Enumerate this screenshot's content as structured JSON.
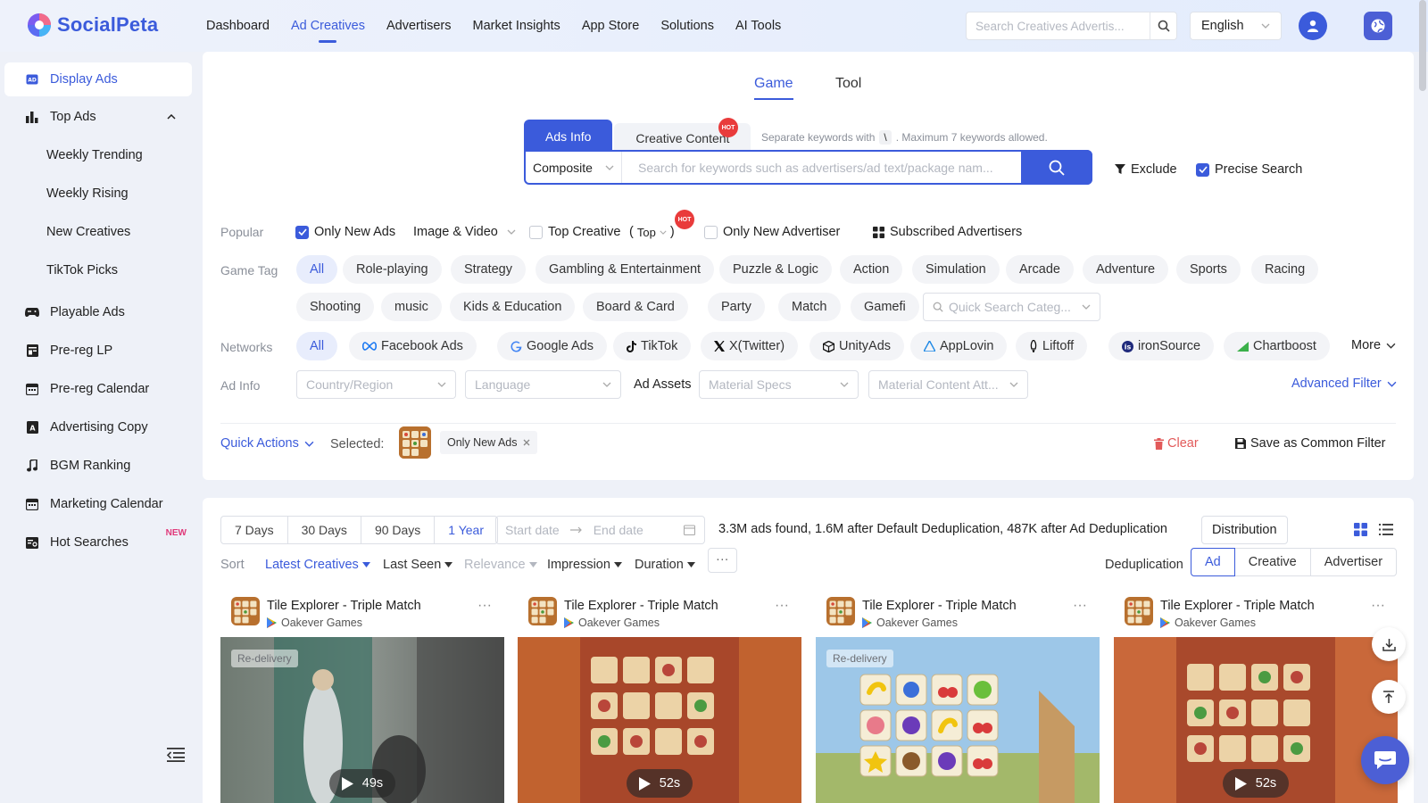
{
  "app": {
    "name": "SocialPeta",
    "brand_color": "#3b5bdb"
  },
  "nav": {
    "items": [
      {
        "label": "Dashboard"
      },
      {
        "label": "Ad Creatives",
        "active": true
      },
      {
        "label": "Advertisers"
      },
      {
        "label": "Market Insights"
      },
      {
        "label": "App Store"
      },
      {
        "label": "Solutions"
      },
      {
        "label": "AI Tools"
      }
    ],
    "search_placeholder": "Search Creatives Advertis...",
    "language": "English"
  },
  "sidebar": {
    "items": [
      {
        "label": "Display Ads",
        "icon": "ad-icon",
        "active": true
      },
      {
        "label": "Top Ads",
        "icon": "bar-chart-icon",
        "expanded": true
      },
      {
        "label": "Weekly Trending",
        "sub": true
      },
      {
        "label": "Weekly Rising",
        "sub": true
      },
      {
        "label": "New Creatives",
        "sub": true
      },
      {
        "label": "TikTok Picks",
        "sub": true
      },
      {
        "label": "Playable Ads",
        "icon": "gamepad-icon"
      },
      {
        "label": "Pre-reg LP",
        "icon": "page-icon"
      },
      {
        "label": "Pre-reg Calendar",
        "icon": "calendar-icon"
      },
      {
        "label": "Advertising Copy",
        "icon": "copy-icon"
      },
      {
        "label": "BGM Ranking",
        "icon": "music-icon"
      },
      {
        "label": "Marketing Calendar",
        "icon": "calendar-icon"
      },
      {
        "label": "Hot Searches",
        "icon": "search-list-icon",
        "badge": "NEW"
      }
    ]
  },
  "filters": {
    "category_tabs": [
      "Game",
      "Tool"
    ],
    "active_category": "Game",
    "search_tabs": [
      "Ads Info",
      "Creative Content"
    ],
    "hot_badge": "HOT",
    "hint_prefix": "Separate keywords with",
    "hint_key": "\\",
    "hint_suffix": ". Maximum 7 keywords allowed.",
    "search_mode": "Composite",
    "search_placeholder": "Search for keywords such as advertisers/ad text/package nam...",
    "exclude_label": "Exclude",
    "precise_label": "Precise Search",
    "popular": {
      "label": "Popular",
      "only_new_ads": "Only New Ads",
      "media_type": "Image & Video",
      "top_creative": "Top Creative",
      "top_select_open": "(",
      "top_select": "Top",
      "top_select_close": ")",
      "only_new_advertiser": "Only New Advertiser",
      "subscribed": "Subscribed Advertisers"
    },
    "game_tag": {
      "label": "Game Tag",
      "row1": [
        "All",
        "Role-playing",
        "Strategy",
        "Gambling & Entertainment",
        "Puzzle & Logic",
        "Action",
        "Simulation",
        "Arcade",
        "Adventure",
        "Sports",
        "Racing"
      ],
      "row2": [
        "Shooting",
        "music",
        "Kids & Education",
        "Board & Card",
        "Party",
        "Match",
        "Gamefi"
      ],
      "quick_search_placeholder": "Quick Search Categ..."
    },
    "networks": {
      "label": "Networks",
      "items": [
        "All",
        "Facebook Ads",
        "Google Ads",
        "TikTok",
        "X(Twitter)",
        "UnityAds",
        "AppLovin",
        "Liftoff",
        "ironSource",
        "Chartboost"
      ],
      "more": "More"
    },
    "ad_info": {
      "label": "Ad Info",
      "country": "Country/Region",
      "language": "Language",
      "assets_label": "Ad Assets",
      "specs": "Material Specs",
      "content_attr": "Material Content Att...",
      "advanced": "Advanced Filter"
    },
    "quick_actions": "Quick Actions",
    "selected_label": "Selected:",
    "selected_chip": "Only New Ads",
    "clear": "Clear",
    "save_filter": "Save as Common Filter"
  },
  "results": {
    "date_ranges": [
      "7 Days",
      "30 Days",
      "90 Days",
      "1 Year"
    ],
    "active_range": "1 Year",
    "start_placeholder": "Start date",
    "end_placeholder": "End date",
    "summary": "3.3M ads found, 1.6M after Default Deduplication, 487K after Ad Deduplication",
    "distribution": "Distribution",
    "sort_label": "Sort",
    "sort_options": [
      "Latest Creatives",
      "Last Seen",
      "Relevance",
      "Impression",
      "Duration"
    ],
    "active_sort": "Latest Creatives",
    "more": "···",
    "dedup_label": "Deduplication",
    "dedup_options": [
      "Ad",
      "Creative",
      "Advertiser"
    ],
    "active_dedup": "Ad",
    "cards": [
      {
        "title": "Tile Explorer - Triple Match",
        "publisher": "Oakever Games",
        "redelivery": "Re-delivery",
        "duration": "49s"
      },
      {
        "title": "Tile Explorer - Triple Match",
        "publisher": "Oakever Games",
        "redelivery": "",
        "duration": "52s"
      },
      {
        "title": "Tile Explorer - Triple Match",
        "publisher": "Oakever Games",
        "redelivery": "Re-delivery",
        "duration": ""
      },
      {
        "title": "Tile Explorer - Triple Match",
        "publisher": "Oakever Games",
        "redelivery": "",
        "duration": "52s"
      }
    ]
  }
}
